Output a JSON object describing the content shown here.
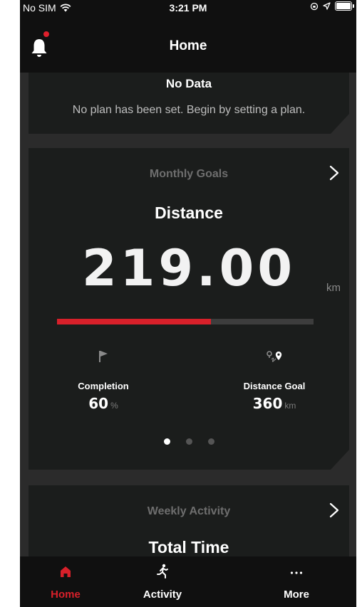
{
  "status_bar": {
    "carrier": "No SIM",
    "time": "3:21 PM"
  },
  "nav": {
    "title": "Home",
    "has_notification": true
  },
  "plan_card": {
    "title": "No Data",
    "message": "No plan has been set. Begin by setting a plan."
  },
  "goal_card": {
    "header": "Monthly Goals",
    "metric": "Distance",
    "value": "219.00",
    "unit": "km",
    "progress_fraction": 0.6,
    "completion": {
      "label": "Completion",
      "value": "60",
      "unit": "%"
    },
    "distance_goal": {
      "label": "Distance Goal",
      "value": "360",
      "unit": "km"
    },
    "page_count": 3,
    "active_page": 0
  },
  "weekly_card": {
    "header": "Weekly Activity",
    "metric": "Total Time"
  },
  "tabbar": {
    "tabs": [
      {
        "label": "Home",
        "icon": "home-icon",
        "active": true
      },
      {
        "label": "Activity",
        "icon": "running-person-icon",
        "active": false
      },
      {
        "label": "More",
        "icon": "more-dots-icon",
        "active": false
      }
    ]
  },
  "colors": {
    "accent": "#d8202a",
    "card": "#1b1d1c",
    "background": "#2b2b2b"
  }
}
